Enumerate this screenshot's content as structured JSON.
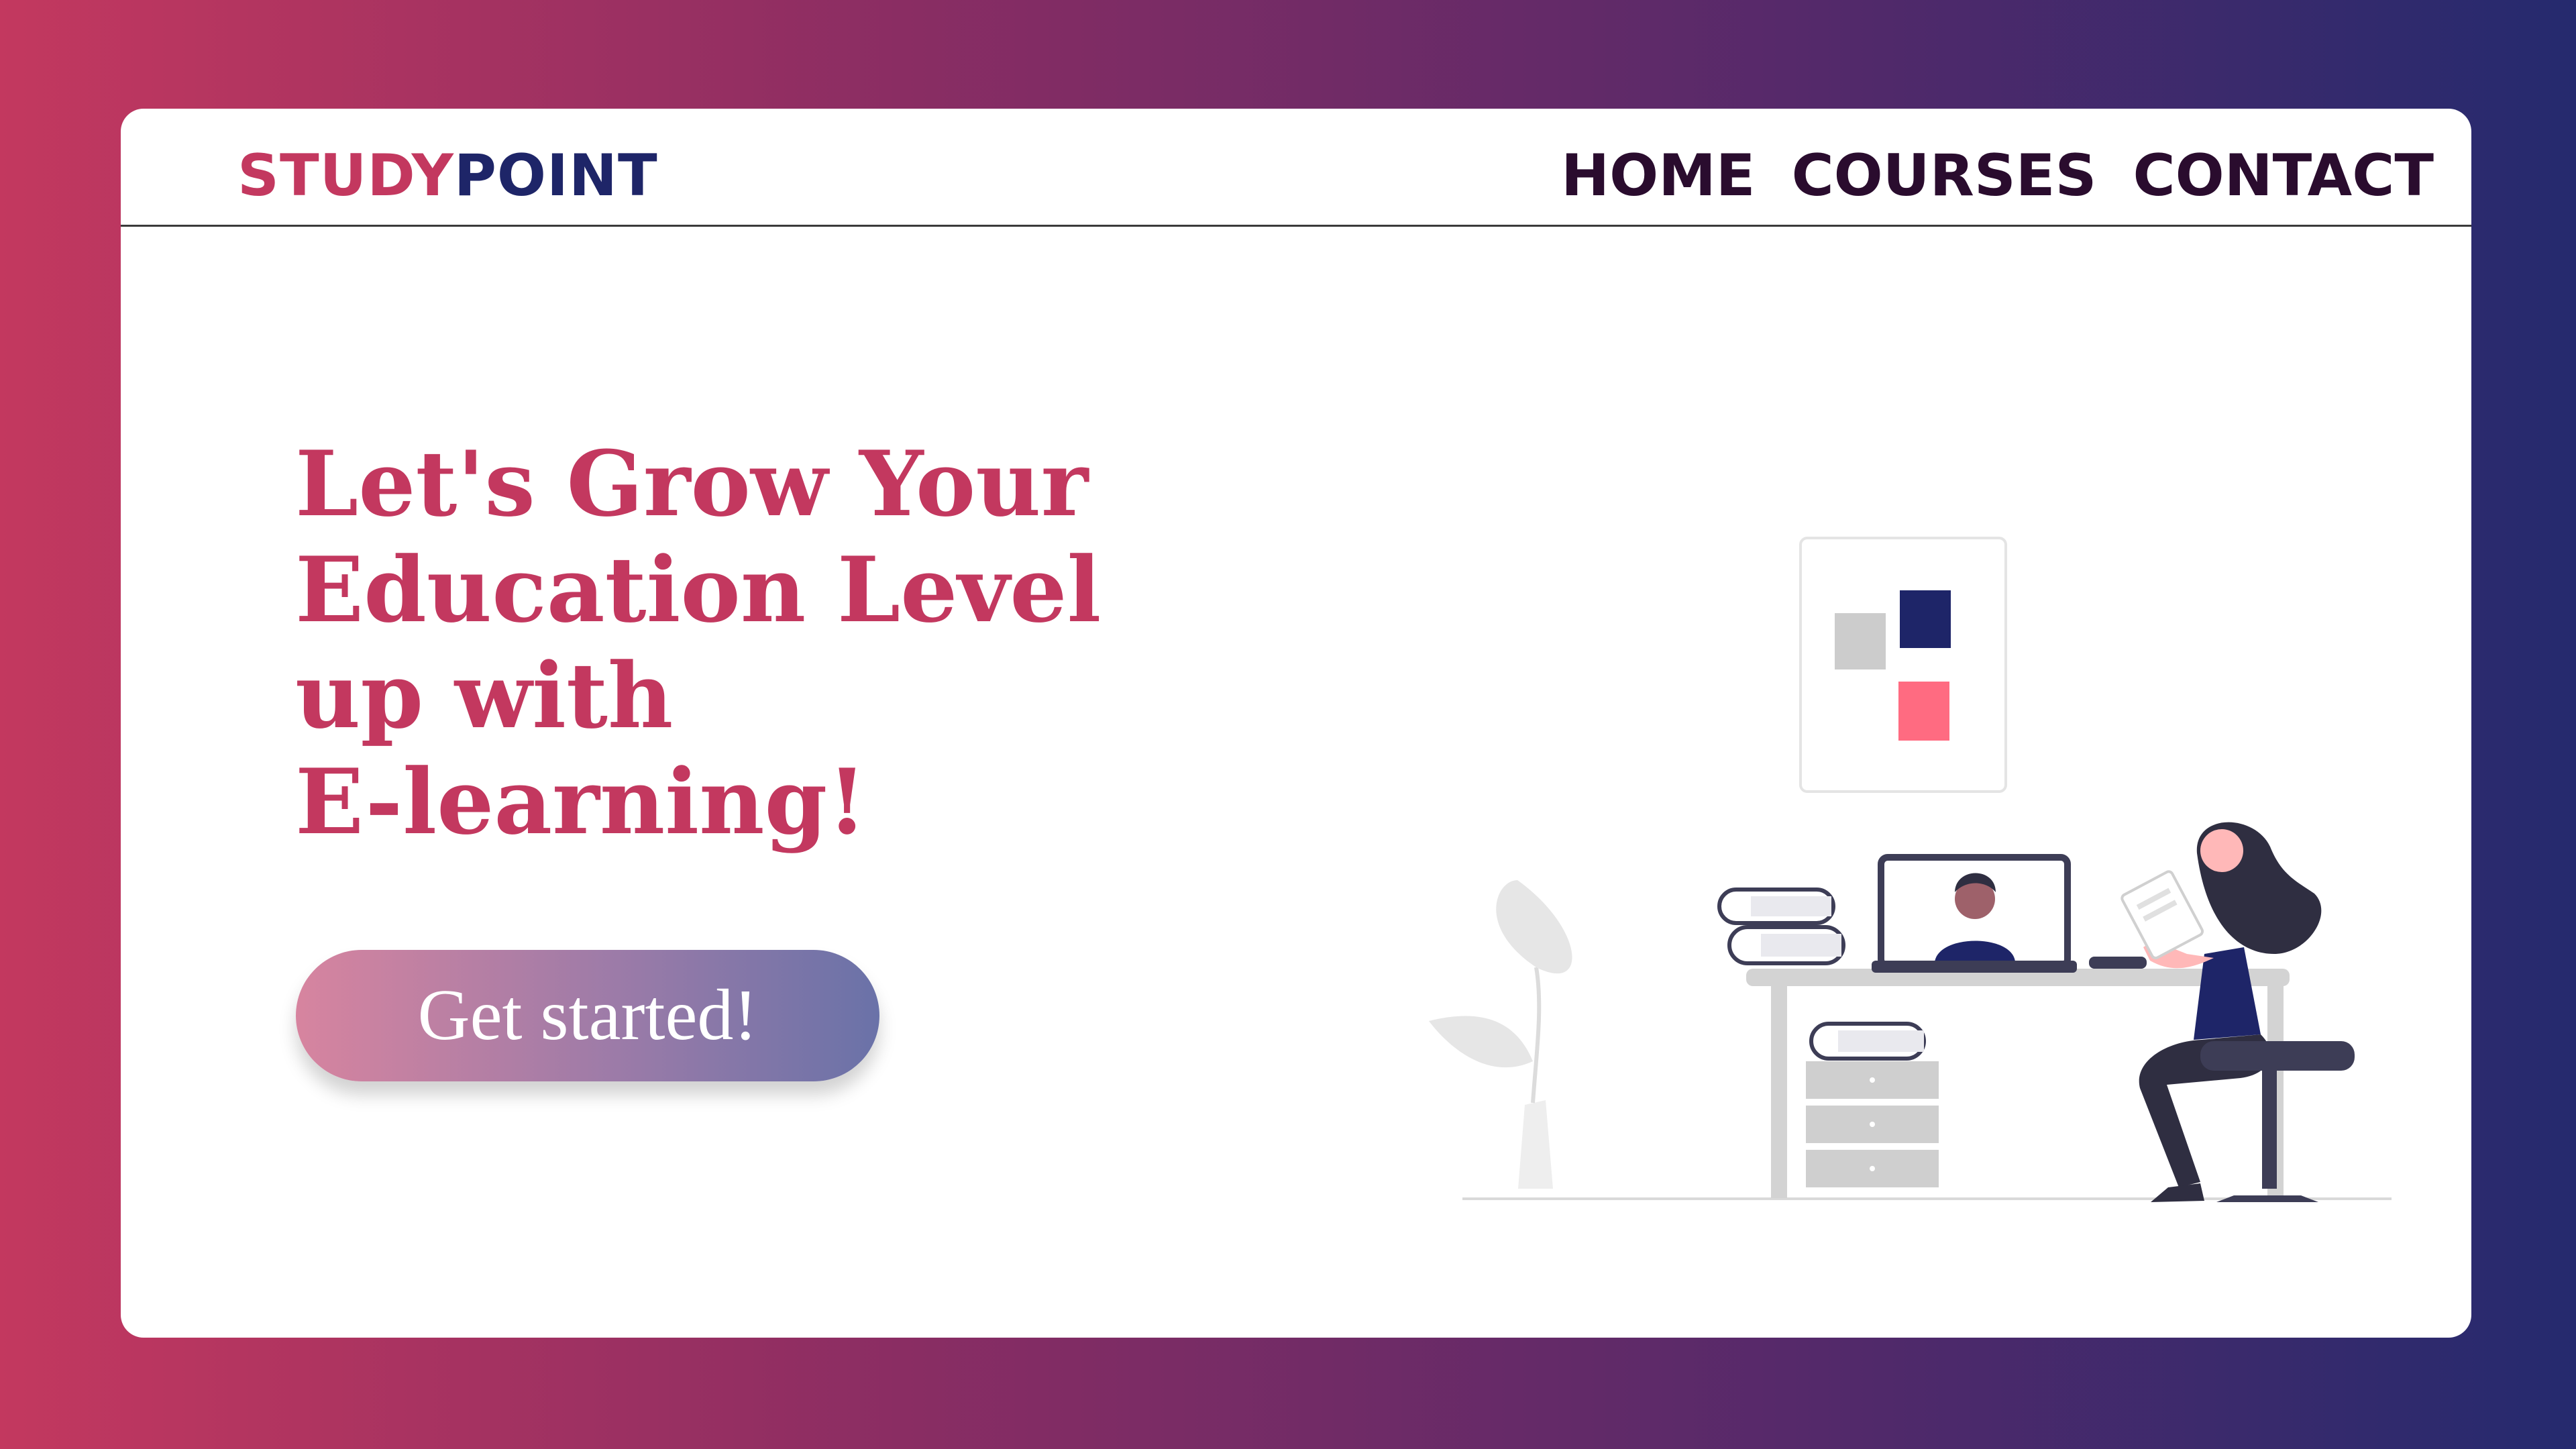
{
  "header": {
    "logo_part1": "STUDY",
    "logo_part2": "POINT",
    "nav": {
      "home": "HOME",
      "courses": "COURSES",
      "contact": "CONTACT"
    }
  },
  "hero": {
    "headline_lines": [
      "Let's Grow Your",
      "Education Level",
      "up with",
      "E-learning!"
    ],
    "cta_label": "Get started!"
  },
  "colors": {
    "brand_pink": "#c3385f",
    "brand_navy": "#1e2568",
    "nav_text": "#2a0c2e",
    "accent_red": "#ff6b81"
  },
  "illustration": {
    "icons": [
      "wall-art-icon",
      "plant-icon",
      "books-icon",
      "laptop-icon",
      "person-icon",
      "desk-icon",
      "stool-icon"
    ]
  }
}
